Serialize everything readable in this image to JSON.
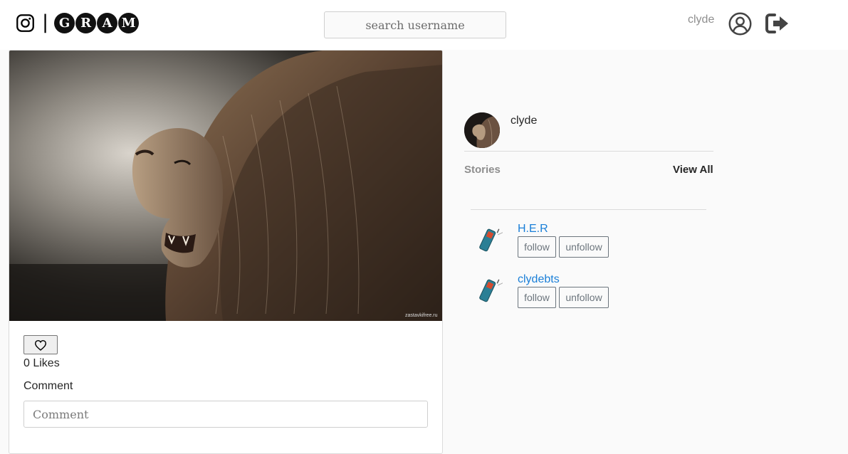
{
  "header": {
    "brand_letters": [
      "G",
      "R",
      "A",
      "M"
    ],
    "brand_separator": "|",
    "logo_icon": "instagram-icon",
    "search_placeholder": "search username",
    "username": "clyde",
    "profile_icon": "user-circle-icon",
    "logout_icon": "sign-out-icon"
  },
  "post": {
    "image_alt": "lion",
    "watermark": "zastavkifree.ru",
    "like_icon": "heart-outline-icon",
    "likes_text": "0 Likes",
    "comment_label": "Comment",
    "comment_placeholder": "Comment"
  },
  "sidebar": {
    "profile_name": "clyde",
    "stories_label": "Stories",
    "view_all_label": "View All",
    "suggestions": [
      {
        "name": "H.E.R",
        "follow_label": "follow",
        "unfollow_label": "unfollow",
        "icon": "phone-icon"
      },
      {
        "name": "clydebts",
        "follow_label": "follow",
        "unfollow_label": "unfollow",
        "icon": "phone-icon"
      }
    ]
  },
  "colors": {
    "page_bg": "#fafafa",
    "link_blue": "#1a7fd8",
    "muted_gray": "#8e8e8e",
    "border": "#dbdbdb"
  }
}
